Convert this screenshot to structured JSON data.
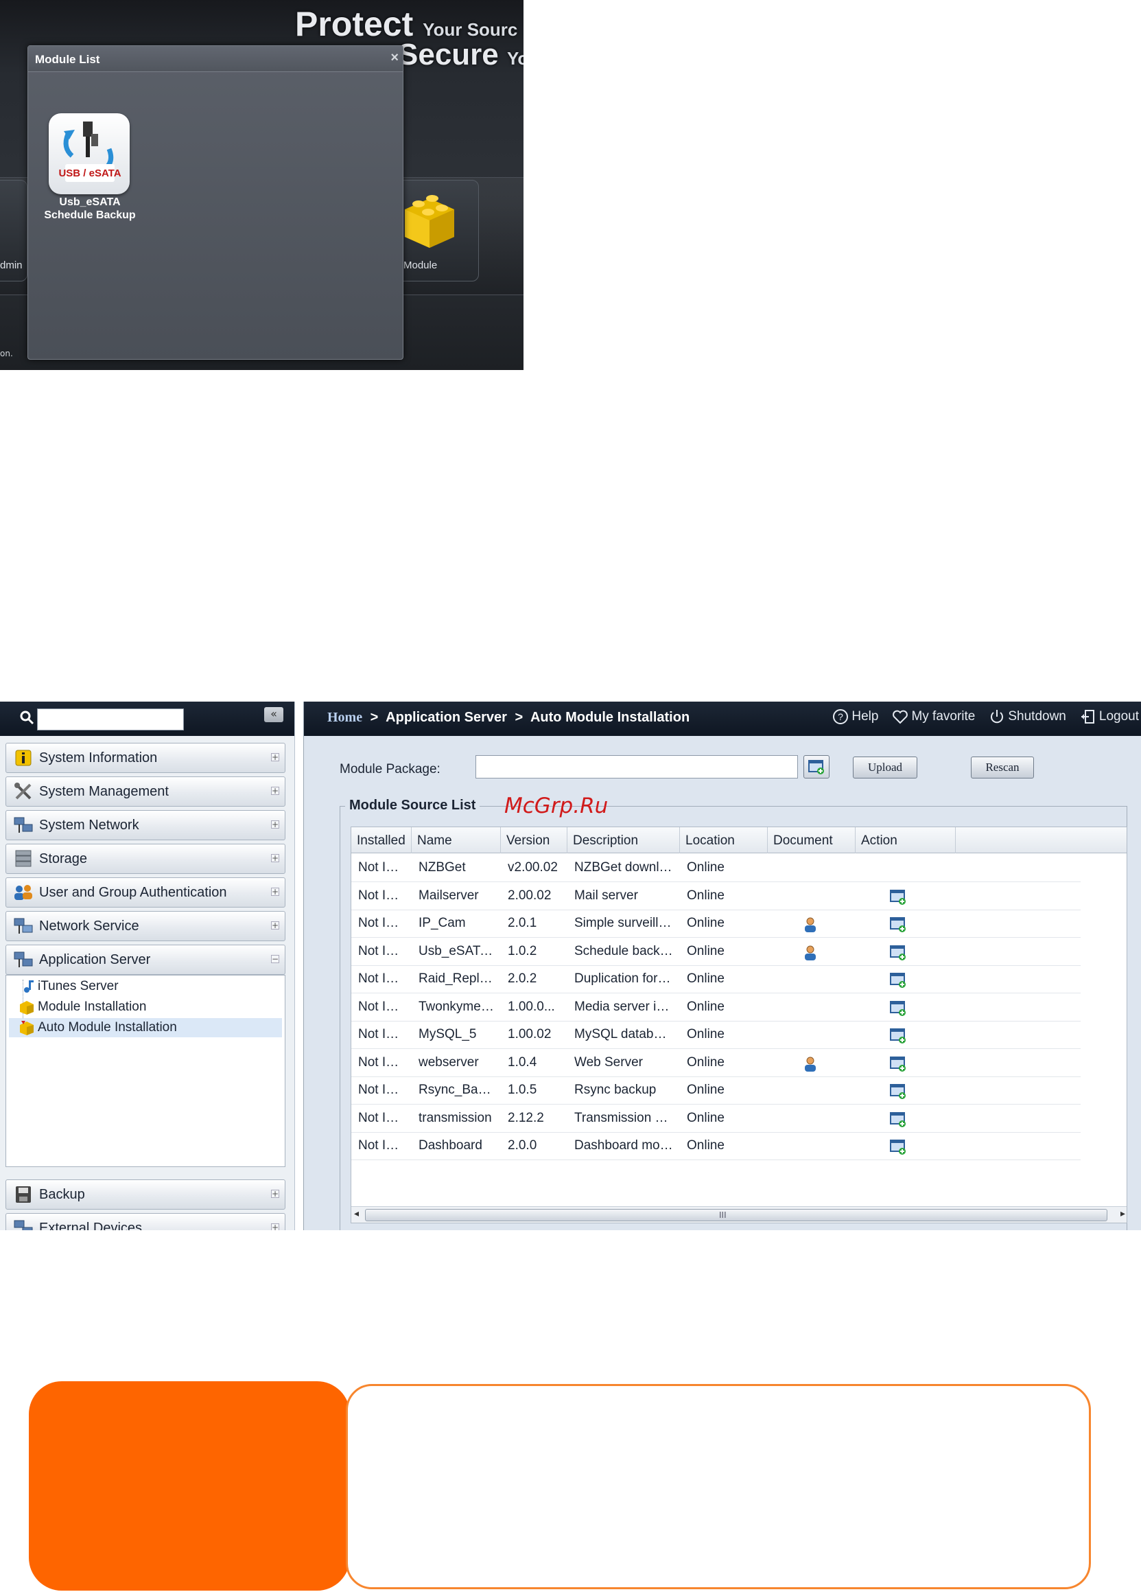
{
  "module_list_window": {
    "banner_line1": "Protect",
    "banner_line1_small": "Your Sourc",
    "banner_line2": "Secure",
    "banner_line2_small": "Yo",
    "modal_title": "Module List",
    "close_glyph": "×",
    "module_icon_text": "USB / eSATA",
    "module_label_line1": "Usb_eSATA",
    "module_label_line2": "Schedule Backup",
    "tile_left_label": "dmin",
    "tile_right_label": "Module",
    "footer_fragment": "on."
  },
  "sidebar": {
    "collapse_glyph": "«",
    "search_placeholder": "",
    "groups": [
      {
        "label": "System Information",
        "icon": "info-icon",
        "toggle": "+"
      },
      {
        "label": "System Management",
        "icon": "tools-icon",
        "toggle": "+"
      },
      {
        "label": "System Network",
        "icon": "network-icon",
        "toggle": "+"
      },
      {
        "label": "Storage",
        "icon": "storage-icon",
        "toggle": "+"
      },
      {
        "label": "User and Group Authentication",
        "icon": "users-icon",
        "toggle": "+"
      },
      {
        "label": "Network Service",
        "icon": "network-service-icon",
        "toggle": "+"
      },
      {
        "label": "Application Server",
        "icon": "app-server-icon",
        "toggle": "−"
      }
    ],
    "tree_items": [
      {
        "label": "iTunes Server",
        "icon": "music-note-icon"
      },
      {
        "label": "Module Installation",
        "icon": "module-icon"
      },
      {
        "label": "Auto Module Installation",
        "icon": "auto-module-icon"
      }
    ],
    "bottom_groups": [
      {
        "label": "Backup",
        "icon": "backup-icon",
        "toggle": "+"
      },
      {
        "label": "External Devices",
        "icon": "external-devices-icon",
        "toggle": "+"
      }
    ]
  },
  "topbar": {
    "breadcrumb_home": "Home",
    "breadcrumb_sep": ">",
    "breadcrumb_app": "Application Server",
    "breadcrumb_page": "Auto Module Installation",
    "help": "Help",
    "favorite": "My favorite",
    "shutdown": "Shutdown",
    "logout": "Logout"
  },
  "form": {
    "package_label": "Module Package:",
    "package_value": "",
    "upload_label": "Upload",
    "rescan_label": "Rescan",
    "legend": "Module Source List",
    "watermark": "McGrp.Ru"
  },
  "table": {
    "columns": [
      "Installed",
      "Name",
      "Version",
      "Description",
      "Location",
      "Document",
      "Action"
    ],
    "rows": [
      {
        "installed": "Not Installed",
        "name": "NZBGet",
        "version": "v2.00.02",
        "description": "NZBGet download",
        "location": "Online",
        "doc": false,
        "action": false
      },
      {
        "installed": "Not Installed",
        "name": "Mailserver",
        "version": "2.00.02",
        "description": "Mail server",
        "location": "Online",
        "doc": false,
        "action": true
      },
      {
        "installed": "Not Installed",
        "name": "IP_Cam",
        "version": "2.0.1",
        "description": "Simple surveillance",
        "location": "Online",
        "doc": true,
        "action": true
      },
      {
        "installed": "Not Installed",
        "name": "Usb_eSATA_Bac...",
        "version": "1.0.2",
        "description": "Schedule backup utilit...",
        "location": "Online",
        "doc": true,
        "action": true
      },
      {
        "installed": "Not Installed",
        "name": "Raid_Replication",
        "version": "2.0.2",
        "description": "Duplication for create...",
        "location": "Online",
        "doc": false,
        "action": true
      },
      {
        "installed": "Not Installed",
        "name": "Twonkymedia",
        "version": "1.00.0...",
        "description": "Media server in DLNA",
        "location": "Online",
        "doc": false,
        "action": true
      },
      {
        "installed": "Not Installed",
        "name": "MySQL_5",
        "version": "1.00.02",
        "description": "MySQL database",
        "location": "Online",
        "doc": false,
        "action": true
      },
      {
        "installed": "Not Installed",
        "name": "webserver",
        "version": "1.0.4",
        "description": "Web Server",
        "location": "Online",
        "doc": true,
        "action": true
      },
      {
        "installed": "Not Installed",
        "name": "Rsync_Backup",
        "version": "1.0.5",
        "description": "Rsync backup",
        "location": "Online",
        "doc": false,
        "action": true
      },
      {
        "installed": "Not Installed",
        "name": "transmission",
        "version": "2.12.2",
        "description": "Transmission module",
        "location": "Online",
        "doc": false,
        "action": true
      },
      {
        "installed": "Not Installed",
        "name": "Dashboard",
        "version": "2.0.0",
        "description": "Dashboard module",
        "location": "Online",
        "doc": false,
        "action": true
      }
    ],
    "scroll_grip": "III",
    "scroll_left": "◂",
    "scroll_right": "▸"
  },
  "colors": {
    "accent_orange": "#fe6500",
    "note_border": "#f7862e",
    "watermark_red": "#d11a1a"
  }
}
